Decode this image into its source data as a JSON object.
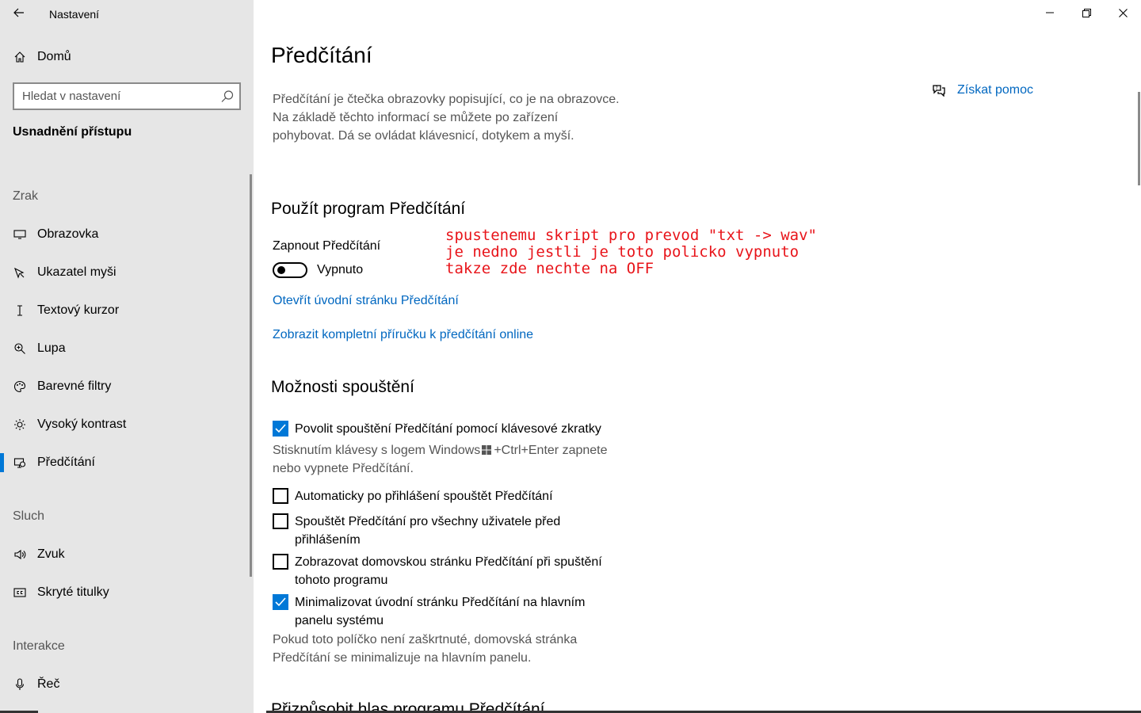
{
  "app": {
    "title": "Nastavení",
    "back_icon": "back-arrow-icon"
  },
  "sidebar": {
    "home_label": "Domů",
    "search_placeholder": "Hledat v nastavení",
    "section_title": "Usnadnění přístupu",
    "groups": [
      {
        "heading": "Zrak",
        "items": [
          {
            "label": "Obrazovka",
            "icon": "monitor-icon"
          },
          {
            "label": "Ukazatel myši",
            "icon": "mouse-pointer-icon"
          },
          {
            "label": "Textový kurzor",
            "icon": "text-cursor-icon"
          },
          {
            "label": "Lupa",
            "icon": "magnifier-icon"
          },
          {
            "label": "Barevné filtry",
            "icon": "palette-icon"
          },
          {
            "label": "Vysoký kontrast",
            "icon": "sun-icon"
          },
          {
            "label": "Předčítání",
            "icon": "narrator-icon",
            "active": true
          }
        ]
      },
      {
        "heading": "Sluch",
        "items": [
          {
            "label": "Zvuk",
            "icon": "speaker-icon"
          },
          {
            "label": "Skryté titulky",
            "icon": "closed-captions-icon"
          }
        ]
      },
      {
        "heading": "Interakce",
        "items": [
          {
            "label": "Řeč",
            "icon": "microphone-icon"
          }
        ]
      }
    ]
  },
  "main": {
    "title": "Předčítání",
    "description": "Předčítání je čtečka obrazovky popisující, co je na obrazovce. Na základě těchto informací se můžete po zařízení pohybovat. Dá se ovládat klávesnicí, dotykem a myší.",
    "help_label": "Získat pomoc",
    "use_section": {
      "heading": "Použít program Předčítání",
      "toggle_label": "Zapnout Předčítání",
      "toggle_state": "Vypnuto",
      "toggle_on": false,
      "link_open": "Otevřít úvodní stránku Předčítání",
      "link_guide": "Zobrazit kompletní příručku k předčítání online"
    },
    "annotation": "spustenemu skript pro prevod \"txt -> wav\"\nje nedno jestli je toto policko vypnuto\ntakze zde nechte na OFF",
    "startup_section": {
      "heading": "Možnosti spouštění",
      "options": [
        {
          "label": "Povolit spouštění Předčítání pomocí klávesové zkratky",
          "checked": true
        },
        {
          "label": "Automaticky po přihlášení spouštět Předčítání",
          "checked": false
        },
        {
          "label": "Spouštět Předčítání pro všechny uživatele před přihlášením",
          "checked": false
        },
        {
          "label": "Zobrazovat domovskou stránku Předčítání při spuštění tohoto programu",
          "checked": false
        },
        {
          "label": "Minimalizovat úvodní stránku Předčítání na hlavním panelu systému",
          "checked": true
        }
      ],
      "shortcut_hint_before": "Stisknutím klávesy s logem Windows",
      "shortcut_hint_after": "+Ctrl+Enter zapnete nebo vypnete Předčítání.",
      "minimize_hint": "Pokud toto políčko není zaškrtnuté, domovská stránka Předčítání se minimalizuje na hlavním panelu."
    },
    "cutoff_heading": "Přizpůsobit hlas programu Předčítání"
  },
  "window_controls": {
    "minimize": "minimize-icon",
    "restore": "restore-icon",
    "close": "close-icon"
  }
}
